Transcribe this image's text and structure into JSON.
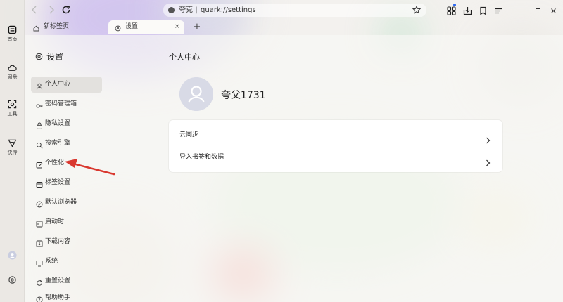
{
  "rail": {
    "items": [
      {
        "label": "首页",
        "icon": "home-icon"
      },
      {
        "label": "网盘",
        "icon": "cloud-icon"
      },
      {
        "label": "工具",
        "icon": "tools-icon"
      },
      {
        "label": "快传",
        "icon": "send-icon"
      }
    ]
  },
  "address_bar": {
    "site": "夸克",
    "separator": "|",
    "url": "quark://settings"
  },
  "tabs": [
    {
      "label": "新标签页",
      "icon": "home-icon",
      "active": false
    },
    {
      "label": "设置",
      "icon": "gear-icon",
      "active": true,
      "close": "×"
    }
  ],
  "new_tab": "+",
  "settings": {
    "title": "设置",
    "menu": [
      {
        "label": "个人中心",
        "icon": "user-icon",
        "active": true
      },
      {
        "label": "密码管理箱",
        "icon": "key-icon",
        "active": false
      },
      {
        "label": "隐私设置",
        "icon": "lock-icon",
        "active": false
      },
      {
        "label": "搜索引擎",
        "icon": "search-icon",
        "active": false
      },
      {
        "label": "个性化",
        "icon": "personalize-icon",
        "active": false
      },
      {
        "label": "标签设置",
        "icon": "tab-icon",
        "active": false
      },
      {
        "label": "默认浏览器",
        "icon": "compass-icon",
        "active": false
      },
      {
        "label": "启动时",
        "icon": "power-icon",
        "active": false
      },
      {
        "label": "下载内容",
        "icon": "download-icon",
        "active": false
      },
      {
        "label": "系统",
        "icon": "system-icon",
        "active": false
      },
      {
        "label": "重置设置",
        "icon": "reset-icon",
        "active": false
      },
      {
        "label": "帮助助手",
        "icon": "help-icon",
        "active": false
      }
    ]
  },
  "main": {
    "section_title": "个人中心",
    "username": "夸父1731",
    "rows": [
      {
        "label": "云同步"
      },
      {
        "label": "导入书签和数据"
      }
    ]
  },
  "colors": {
    "accent_dot": "#2f6bf2",
    "annotation_arrow": "#d9382f"
  }
}
